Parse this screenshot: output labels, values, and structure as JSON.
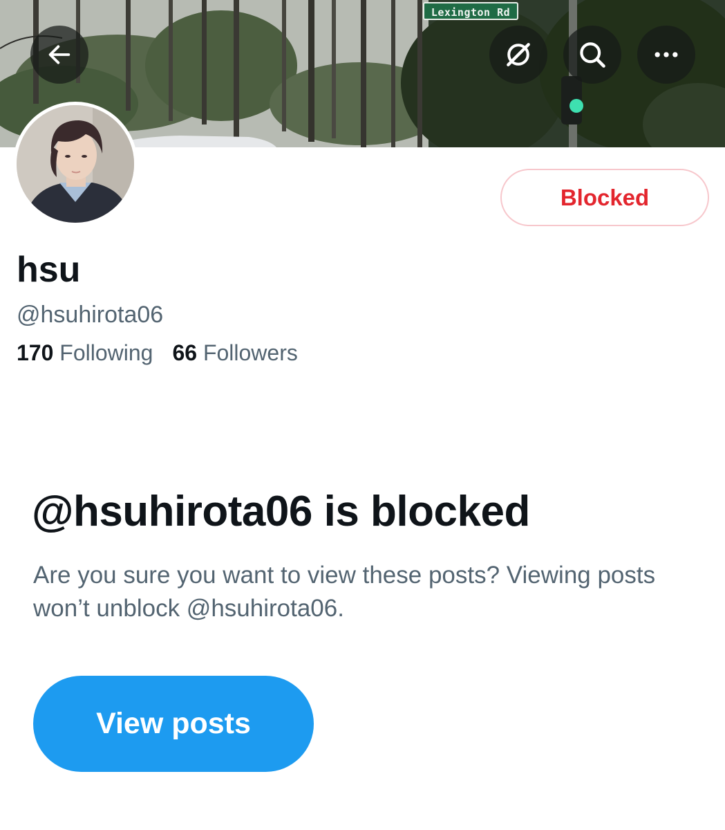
{
  "banner": {
    "street_sign": "Lexington Rd"
  },
  "nav": {
    "back_icon": "arrow-left-icon",
    "grok_icon": "grok-icon",
    "search_icon": "search-icon",
    "more_icon": "more-horizontal-icon"
  },
  "profile": {
    "display_name": "hsu",
    "handle": "@hsuhirota06",
    "relationship_button": "Blocked",
    "following_count": "170",
    "following_label": "Following",
    "followers_count": "66",
    "followers_label": "Followers"
  },
  "notice": {
    "title": "@hsuhirota06 is blocked",
    "description": "Are you sure you want to view these posts? Viewing posts won’t unblock @hsuhirota06.",
    "view_posts_button": "View posts"
  },
  "colors": {
    "text_primary": "#0f1419",
    "text_secondary": "#536471",
    "accent_blue": "#1d9bf0",
    "blocked_red": "#e3262e",
    "blocked_border": "#f7c7cc"
  }
}
